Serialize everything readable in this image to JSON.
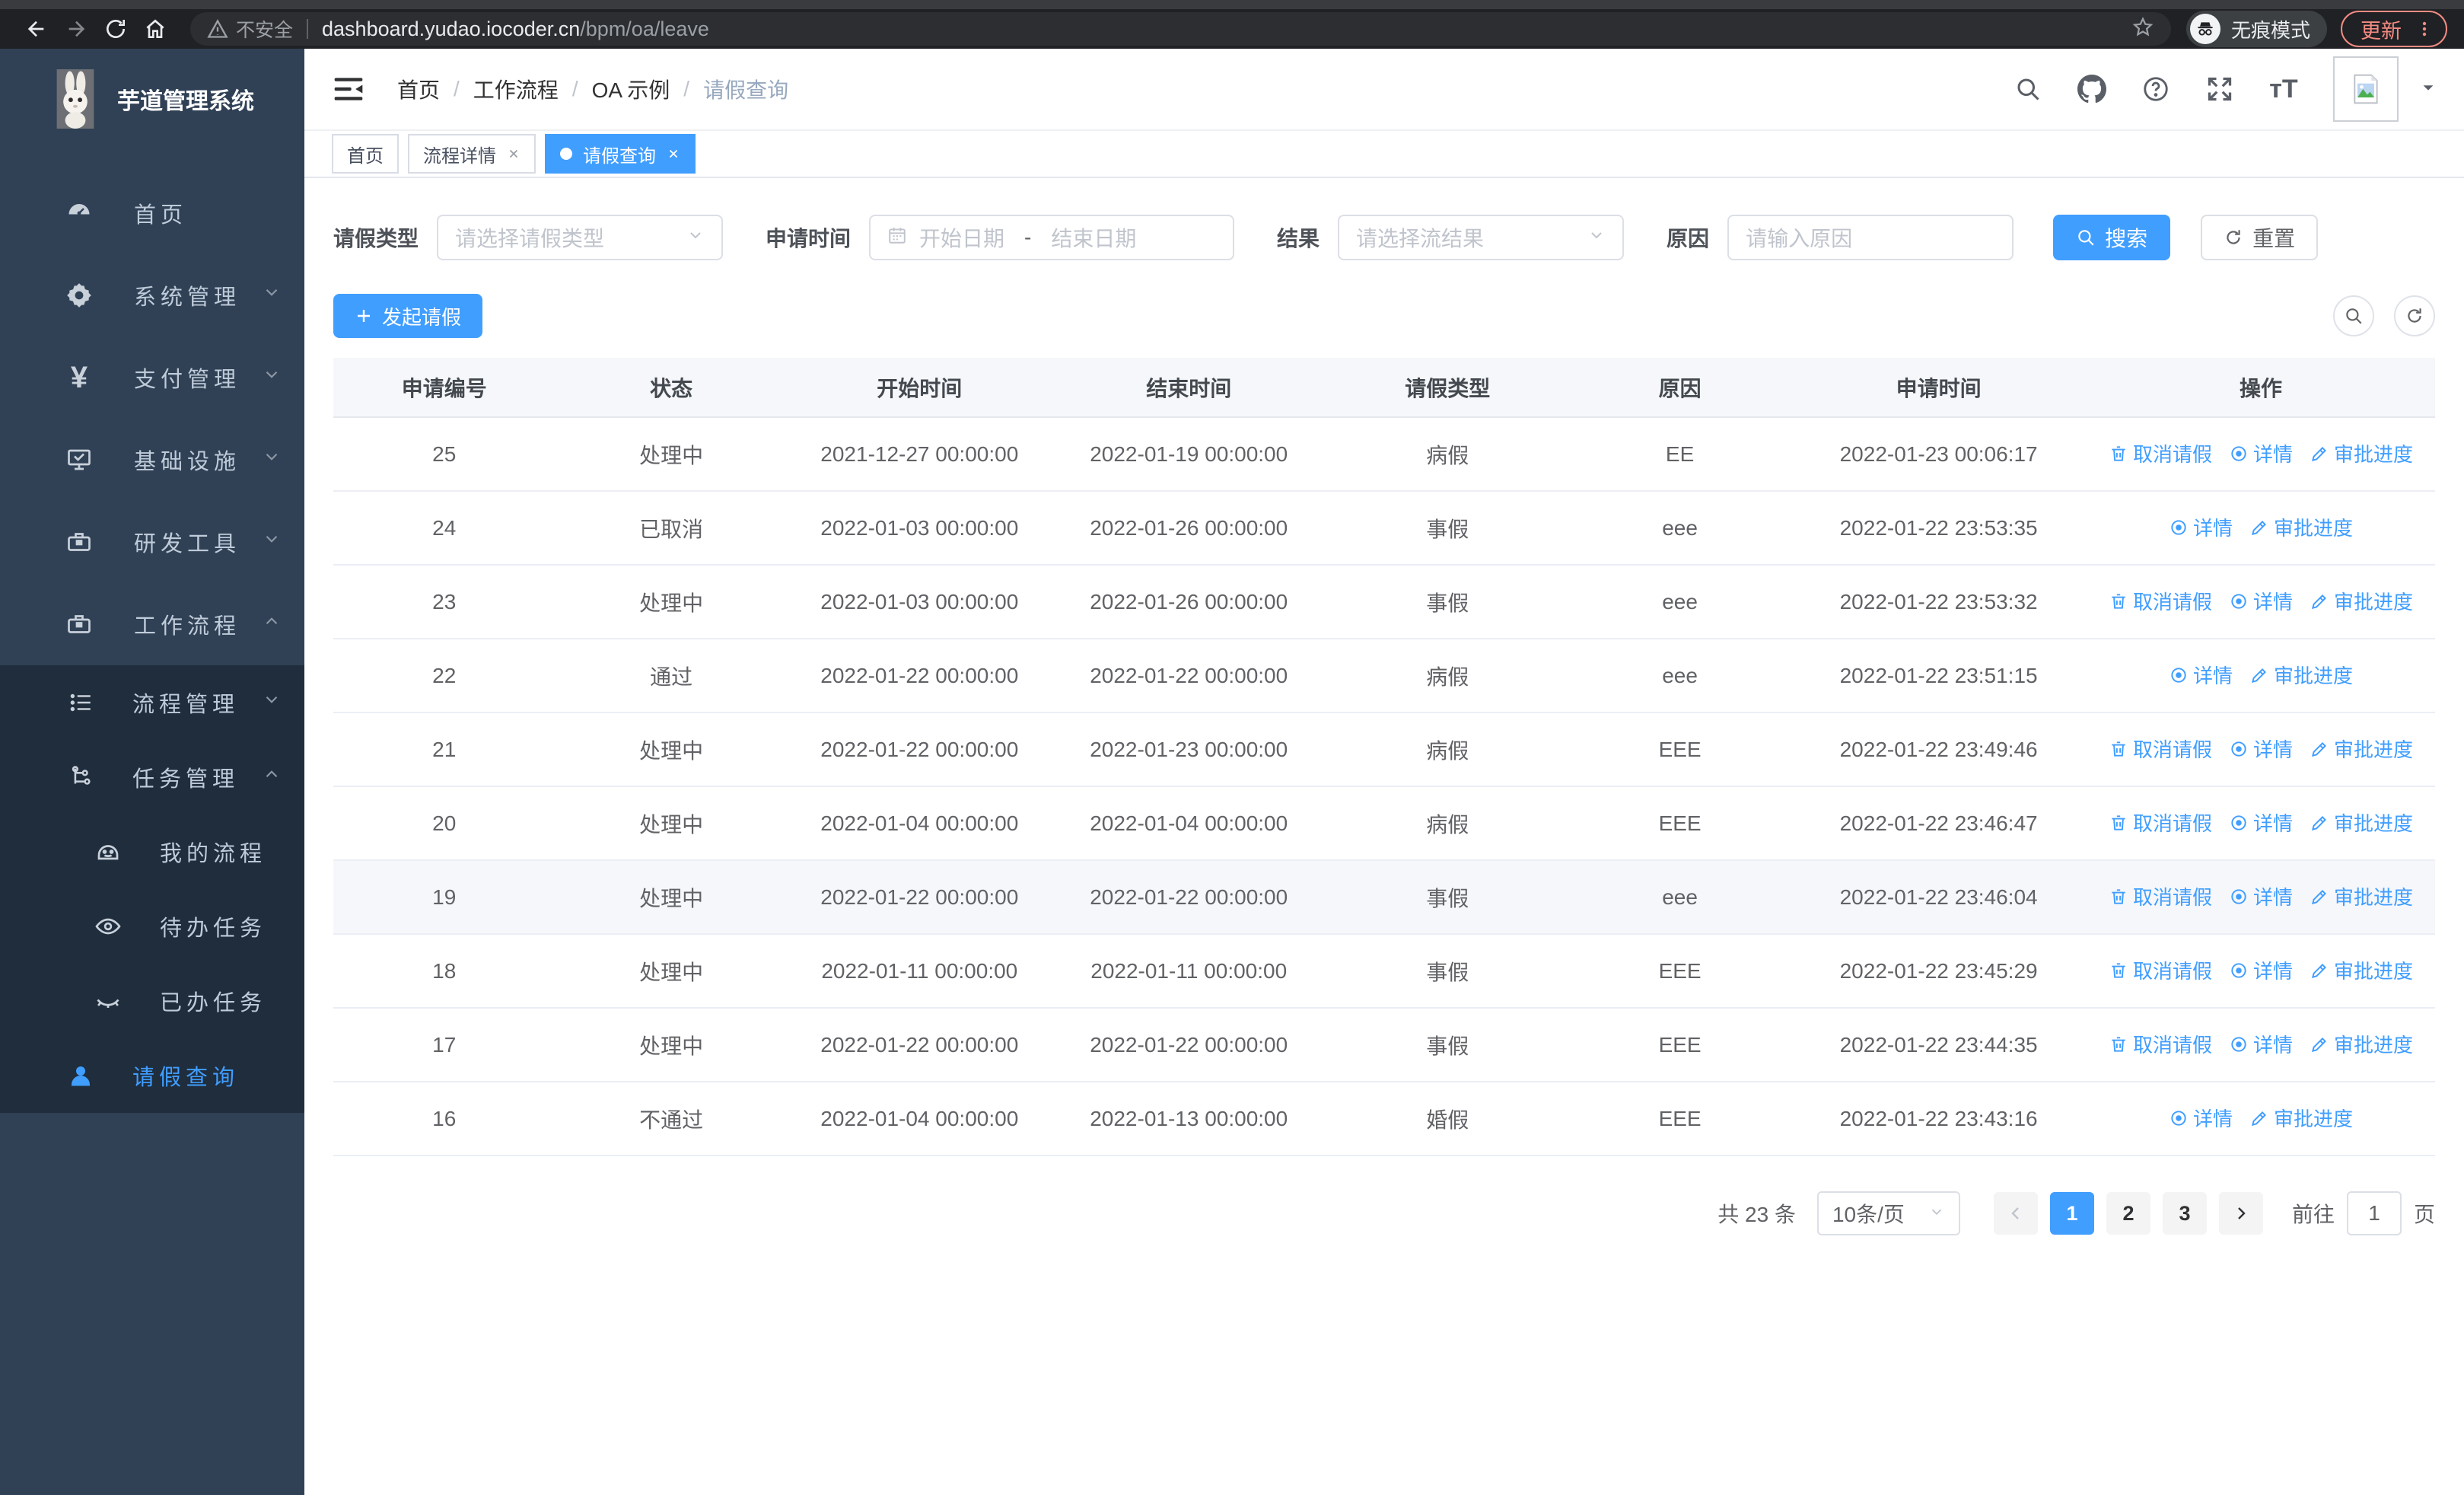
{
  "colors": {
    "accent": "#409eff",
    "sidebar_bg": "#304156",
    "submenu_bg": "#1f2d3d",
    "chrome_bg": "#202124",
    "update_accent": "#f28b82",
    "table_header_bg": "#f5f7fa"
  },
  "browser": {
    "security_label": "不安全",
    "url_host": "dashboard.yudao.iocoder.cn",
    "url_path": "/bpm/oa/leave",
    "incognito_label": "无痕模式",
    "update_label": "更新"
  },
  "sidebar": {
    "app_title": "芋道管理系统",
    "items": [
      {
        "label": "首页"
      },
      {
        "label": "系统管理"
      },
      {
        "label": "支付管理"
      },
      {
        "label": "基础设施"
      },
      {
        "label": "研发工具"
      },
      {
        "label": "工作流程"
      }
    ],
    "workflow_submenu": {
      "process_mgmt": "流程管理",
      "task_mgmt": "任务管理",
      "task_children": [
        "我的流程",
        "待办任务",
        "已办任务"
      ],
      "leave_query": "请假查询"
    }
  },
  "header": {
    "breadcrumb": [
      "首页",
      "工作流程",
      "OA 示例",
      "请假查询"
    ],
    "breadcrumb_separator": "/",
    "tabs": [
      {
        "label": "首页",
        "closable": false,
        "active": false
      },
      {
        "label": "流程详情",
        "closable": true,
        "active": false
      },
      {
        "label": "请假查询",
        "closable": true,
        "active": true
      }
    ]
  },
  "filters": {
    "leave_type_label": "请假类型",
    "leave_type_placeholder": "请选择请假类型",
    "apply_time_label": "申请时间",
    "date_start_placeholder": "开始日期",
    "date_separator": "-",
    "date_end_placeholder": "结束日期",
    "result_label": "结果",
    "result_placeholder": "请选择流结果",
    "reason_label": "原因",
    "reason_placeholder": "请输入原因",
    "search_label": "搜索",
    "reset_label": "重置"
  },
  "toolbar": {
    "create_label": "发起请假"
  },
  "table": {
    "columns": [
      "申请编号",
      "状态",
      "开始时间",
      "结束时间",
      "请假类型",
      "原因",
      "申请时间",
      "操作"
    ],
    "action_labels": {
      "cancel": "取消请假",
      "detail": "详情",
      "progress": "审批进度"
    },
    "rows": [
      {
        "id": "25",
        "status": "处理中",
        "start": "2021-12-27 00:00:00",
        "end": "2022-01-19 00:00:00",
        "type": "病假",
        "reason": "EE",
        "applied": "2022-01-23 00:06:17",
        "actions": [
          "cancel",
          "detail",
          "progress"
        ],
        "highlighted": false
      },
      {
        "id": "24",
        "status": "已取消",
        "start": "2022-01-03 00:00:00",
        "end": "2022-01-26 00:00:00",
        "type": "事假",
        "reason": "eee",
        "applied": "2022-01-22 23:53:35",
        "actions": [
          "detail",
          "progress"
        ],
        "highlighted": false
      },
      {
        "id": "23",
        "status": "处理中",
        "start": "2022-01-03 00:00:00",
        "end": "2022-01-26 00:00:00",
        "type": "事假",
        "reason": "eee",
        "applied": "2022-01-22 23:53:32",
        "actions": [
          "cancel",
          "detail",
          "progress"
        ],
        "highlighted": false
      },
      {
        "id": "22",
        "status": "通过",
        "start": "2022-01-22 00:00:00",
        "end": "2022-01-22 00:00:00",
        "type": "病假",
        "reason": "eee",
        "applied": "2022-01-22 23:51:15",
        "actions": [
          "detail",
          "progress"
        ],
        "highlighted": false
      },
      {
        "id": "21",
        "status": "处理中",
        "start": "2022-01-22 00:00:00",
        "end": "2022-01-23 00:00:00",
        "type": "病假",
        "reason": "EEE",
        "applied": "2022-01-22 23:49:46",
        "actions": [
          "cancel",
          "detail",
          "progress"
        ],
        "highlighted": false
      },
      {
        "id": "20",
        "status": "处理中",
        "start": "2022-01-04 00:00:00",
        "end": "2022-01-04 00:00:00",
        "type": "病假",
        "reason": "EEE",
        "applied": "2022-01-22 23:46:47",
        "actions": [
          "cancel",
          "detail",
          "progress"
        ],
        "highlighted": false
      },
      {
        "id": "19",
        "status": "处理中",
        "start": "2022-01-22 00:00:00",
        "end": "2022-01-22 00:00:00",
        "type": "事假",
        "reason": "eee",
        "applied": "2022-01-22 23:46:04",
        "actions": [
          "cancel",
          "detail",
          "progress"
        ],
        "highlighted": true
      },
      {
        "id": "18",
        "status": "处理中",
        "start": "2022-01-11 00:00:00",
        "end": "2022-01-11 00:00:00",
        "type": "事假",
        "reason": "EEE",
        "applied": "2022-01-22 23:45:29",
        "actions": [
          "cancel",
          "detail",
          "progress"
        ],
        "highlighted": false
      },
      {
        "id": "17",
        "status": "处理中",
        "start": "2022-01-22 00:00:00",
        "end": "2022-01-22 00:00:00",
        "type": "事假",
        "reason": "EEE",
        "applied": "2022-01-22 23:44:35",
        "actions": [
          "cancel",
          "detail",
          "progress"
        ],
        "highlighted": false
      },
      {
        "id": "16",
        "status": "不通过",
        "start": "2022-01-04 00:00:00",
        "end": "2022-01-13 00:00:00",
        "type": "婚假",
        "reason": "EEE",
        "applied": "2022-01-22 23:43:16",
        "actions": [
          "detail",
          "progress"
        ],
        "highlighted": false
      }
    ]
  },
  "pagination": {
    "total": "共 23 条",
    "page_size": "10条/页",
    "pages": [
      "1",
      "2",
      "3"
    ],
    "active_page": "1",
    "goto_label": "前往",
    "goto_value": "1",
    "goto_suffix": "页"
  }
}
